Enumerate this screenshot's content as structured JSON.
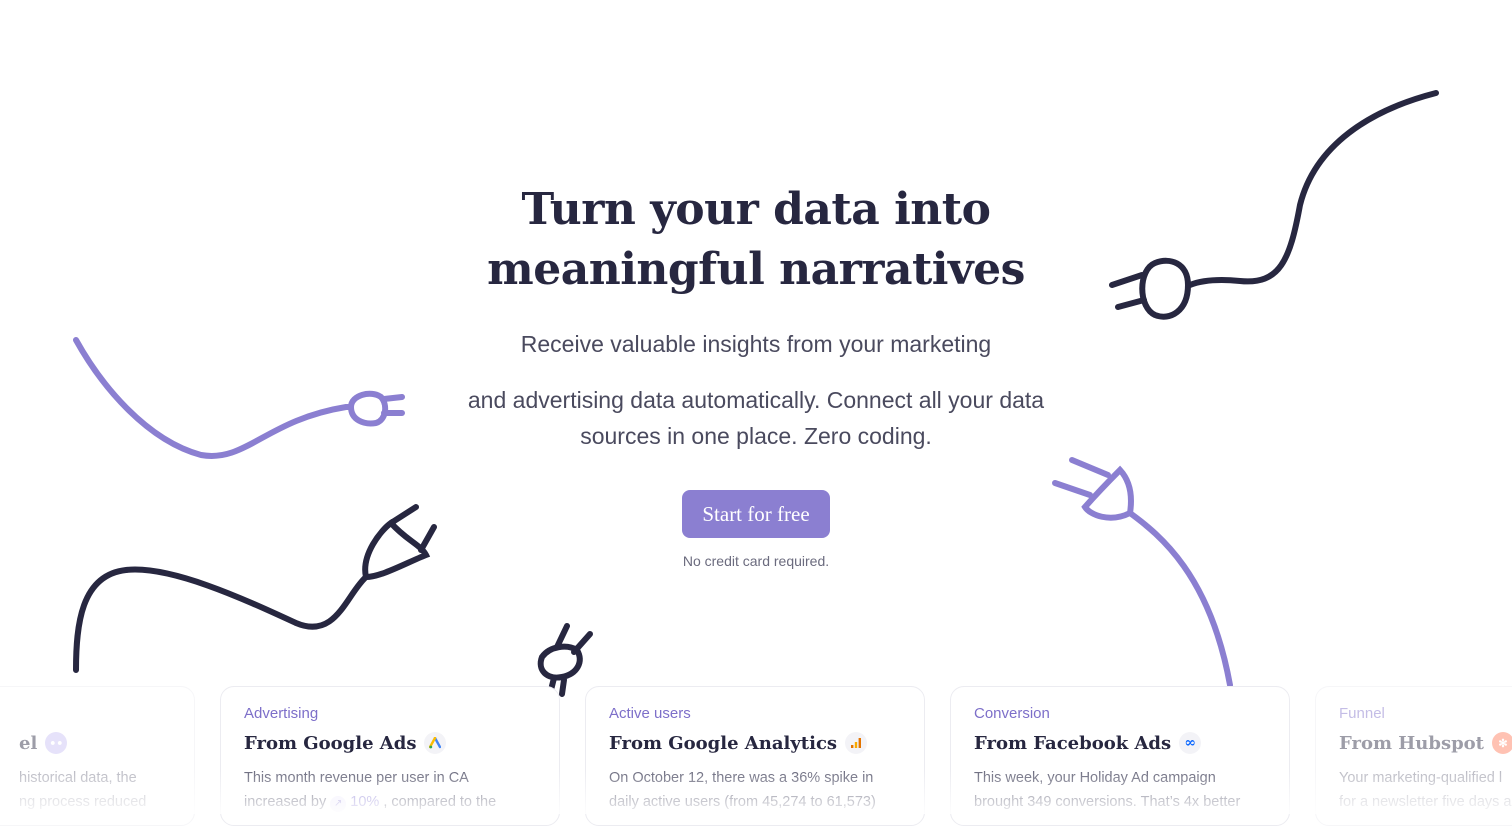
{
  "hero": {
    "title_line1": "Turn your data into",
    "title_line2": "meaningful narratives",
    "subtitle_line1": "Receive valuable insights from your marketing",
    "subtitle_line2": "and advertising data automatically. Connect all your data sources in one place. Zero coding.",
    "cta_label": "Start for free",
    "cta_note": "No credit card required."
  },
  "cards": [
    {
      "title_partial": "el",
      "line1": "historical data, the",
      "line2": "ng process reduced",
      "logo": "funnel-icon"
    },
    {
      "category": "Advertising",
      "title": "From Google Ads",
      "line1": "This month revenue per user in CA",
      "line2a": "increased by",
      "pct": "10%",
      "line2b": ", compared to the",
      "logo": "google-ads-icon"
    },
    {
      "category": "Active users",
      "title": "From Google Analytics",
      "line1": "On October 12, there was a 36% spike in",
      "line2": "daily active users (from 45,274 to 61,573)",
      "logo": "google-analytics-icon"
    },
    {
      "category": "Conversion",
      "title": "From Facebook Ads",
      "line1": "This week, your Holiday Ad campaign",
      "line2": "brought  349 conversions. That’s 4x better",
      "logo": "meta-icon"
    },
    {
      "category": "Funnel",
      "title": "From Hubspot",
      "line1": "Your marketing-qualified l",
      "line2": "for a newsletter five days a",
      "logo": "hubspot-icon"
    }
  ],
  "colors": {
    "accent": "#8b7fd1",
    "dark_plug": "#272740",
    "purple_plug": "#8b7fd1"
  }
}
